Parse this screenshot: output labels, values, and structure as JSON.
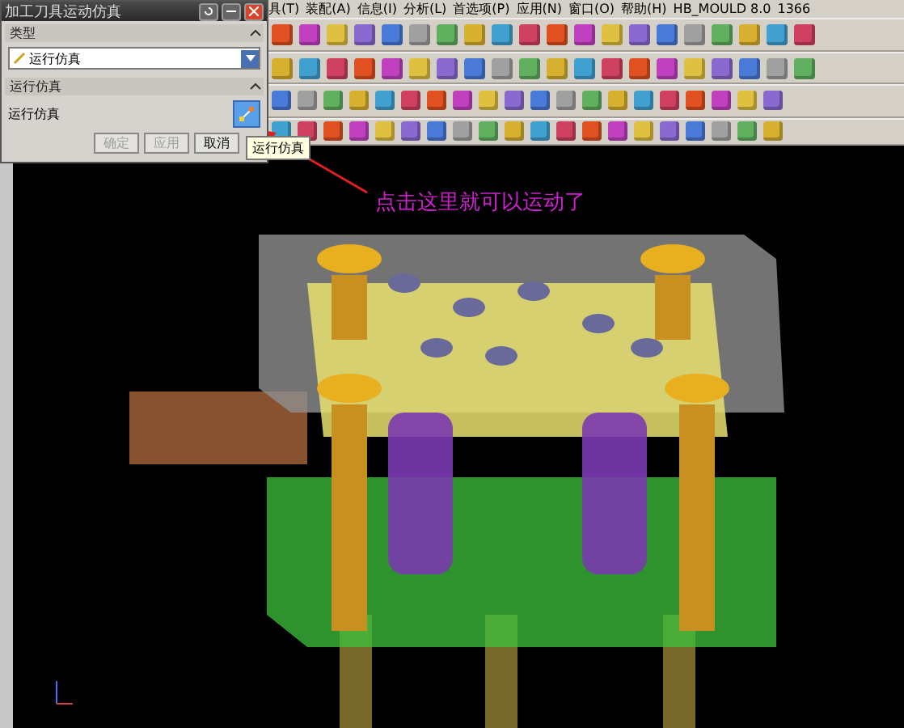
{
  "menu_bar": [
    "具(T)",
    "装配(A)",
    "信息(I)",
    "分析(L)",
    "首选项(P)",
    "应用(N)",
    "窗口(O)",
    "帮助(H)",
    "HB_MOULD 8.0",
    "1366"
  ],
  "dialog": {
    "title": "加工刀具运动仿真",
    "sections": [
      {
        "title": "类型",
        "expanded": true,
        "kind": "dropdown",
        "value": "运行仿真"
      },
      {
        "title": "运行仿真",
        "expanded": true,
        "kind": "action",
        "label": "运行仿真"
      }
    ],
    "buttons": [
      {
        "label": "确定",
        "disabled": true
      },
      {
        "label": "应用",
        "disabled": true
      },
      {
        "label": "取消",
        "disabled": false
      }
    ]
  },
  "tooltip": "运行仿真",
  "annotation": "点击这里就可以运动了"
}
